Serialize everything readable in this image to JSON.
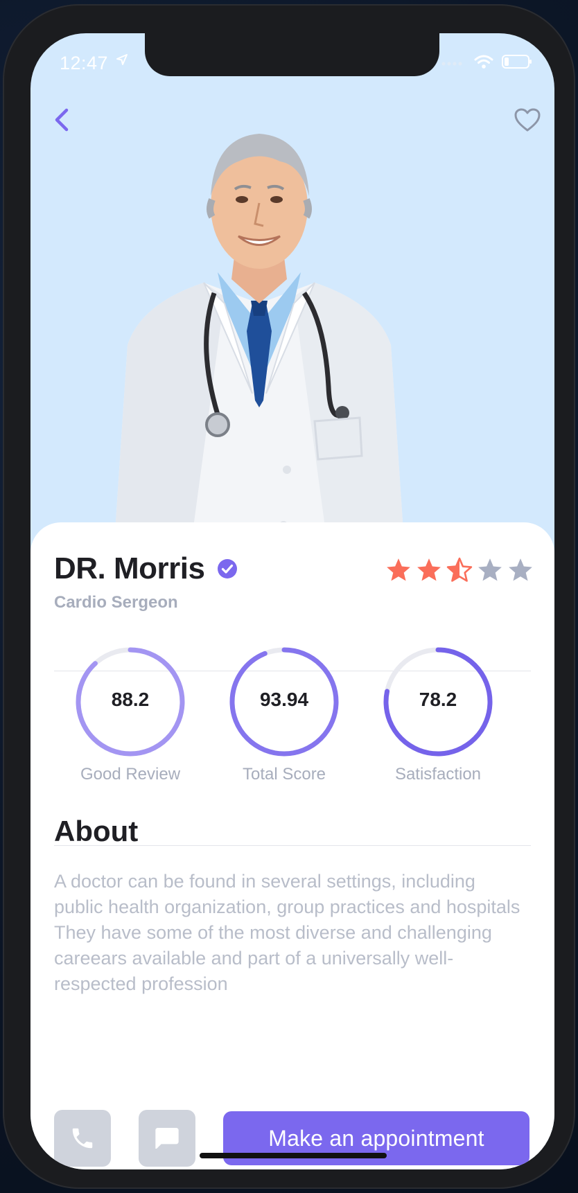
{
  "status_bar": {
    "time": "12:47",
    "location_arrow": "location-arrow-icon",
    "icons": [
      "signal-icon",
      "wifi-icon",
      "battery-icon"
    ]
  },
  "header": {
    "back_icon": "chevron-left-icon",
    "favorite_icon": "heart-outline-icon"
  },
  "doctor": {
    "name": "DR. Morris",
    "verified_icon": "verified-check-icon",
    "specialty": "Cardio Sergeon",
    "rating": 2.5,
    "rating_max": 5
  },
  "stats": [
    {
      "value": "88.2",
      "label": "Good Review",
      "percent": 88.2,
      "color": "#a395f2"
    },
    {
      "value": "93.94",
      "label": "Total Score",
      "percent": 93.94,
      "color": "#8575ee"
    },
    {
      "value": "78.2",
      "label": "Satisfaction",
      "percent": 78.2,
      "color": "#7563ea"
    }
  ],
  "about": {
    "title": "About",
    "text": "A doctor can be found in several settings, including public health organization, group practices and  hospitals They have some of the most diverse and challenging careears available and part of a universally well-respected profession"
  },
  "actions": {
    "call_icon": "phone-icon",
    "message_icon": "chat-icon",
    "appointment_label": "Make an appointment"
  },
  "colors": {
    "accent": "#7b68ee",
    "star_active": "#fa6e5a",
    "star_inactive": "#a8afc2",
    "hero_bg": "#d3e9fd"
  }
}
